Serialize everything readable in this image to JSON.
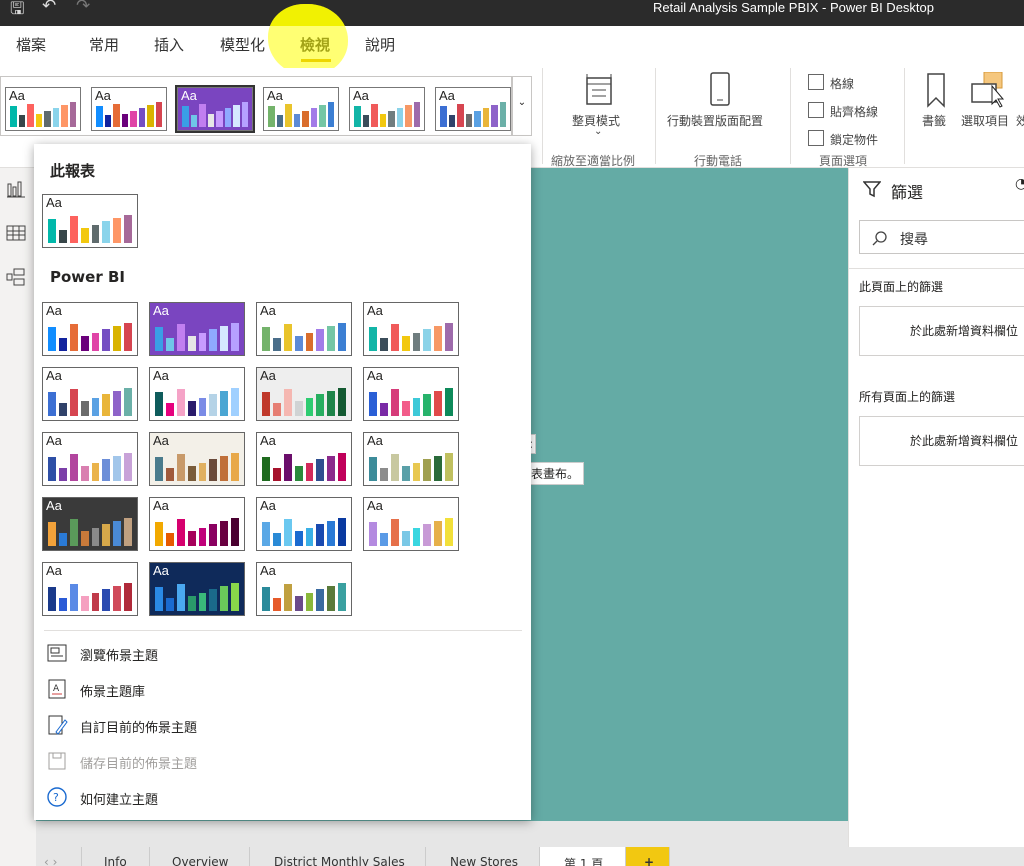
{
  "window": {
    "title": "Retail Analysis Sample PBIX - Power BI Desktop"
  },
  "tabs": [
    {
      "label": "檔案"
    },
    {
      "label": "常用"
    },
    {
      "label": "插入"
    },
    {
      "label": "模型化"
    },
    {
      "label": "檢視"
    },
    {
      "label": "說明"
    }
  ],
  "ribbon": {
    "page_view": "整頁模式",
    "page_view_group": "縮放至適當比例",
    "mobile_layout": "行動裝置版面配置",
    "mobile_group": "行動電話",
    "gridlines": "格線",
    "snap_to_grid": "貼齊格線",
    "lock_objects": "鎖定物件",
    "page_options_group": "頁面選項",
    "bookmarks": "書籤",
    "selection": "選取項目",
    "selection_cut": "效"
  },
  "dropdown": {
    "this_report_header": "此報表",
    "powerbi_header": "Power BI",
    "thumb_text": "Aa",
    "menu": [
      {
        "label": "瀏覽佈景主題",
        "icon": "browse-theme-icon",
        "enabled": true
      },
      {
        "label": "佈景主題庫",
        "icon": "theme-gallery-icon",
        "enabled": true
      },
      {
        "label": "自訂目前的佈景主題",
        "icon": "customize-theme-icon",
        "enabled": true
      },
      {
        "label": "儲存目前的佈景主題",
        "icon": "save-theme-icon",
        "enabled": false
      },
      {
        "label": "如何建立主題",
        "icon": "help-icon",
        "enabled": true
      }
    ]
  },
  "themes": {
    "this_report": [
      {
        "bg": "#ffffff",
        "fg": "#252423",
        "colors": [
          "#01b8aa",
          "#374649",
          "#fd625e",
          "#f2c80f",
          "#5f6b6d",
          "#8ad4eb",
          "#fe9666",
          "#a66999"
        ]
      }
    ],
    "ribbon": [
      {
        "bg": "#ffffff",
        "fg": "#252423",
        "colors": [
          "#01b8aa",
          "#374649",
          "#fd625e",
          "#f2c80f",
          "#5f6b6d",
          "#8ad4eb",
          "#fe9666",
          "#a66999"
        ]
      },
      {
        "bg": "#ffffff",
        "fg": "#252423",
        "colors": [
          "#118dff",
          "#12239e",
          "#e66c37",
          "#6b007b",
          "#e044a7",
          "#744ec2",
          "#d9b300",
          "#d64550"
        ]
      },
      {
        "bg": "#7a45c0",
        "fg": "#ffffff",
        "colors": [
          "#3a9ee6",
          "#6fc6e8",
          "#c17ff0",
          "#e6e6e6",
          "#c89bff",
          "#8fa9ff",
          "#d5e7ff",
          "#b6a1ff"
        ]
      },
      {
        "bg": "#ffffff",
        "fg": "#252423",
        "colors": [
          "#74b36b",
          "#4a6e8a",
          "#e9c42c",
          "#5c8ad6",
          "#d96d2c",
          "#a27ce8",
          "#74c6a5",
          "#3c7fd3"
        ]
      },
      {
        "bg": "#ffffff",
        "fg": "#252423",
        "colors": [
          "#12b5a7",
          "#3b4d5a",
          "#f05a5a",
          "#f2c80f",
          "#6f7d7f",
          "#8bd3e8",
          "#f79865",
          "#9e6bab"
        ]
      },
      {
        "bg": "#ffffff",
        "fg": "#252423",
        "colors": [
          "#3c6fd3",
          "#30426a",
          "#d64550",
          "#6b6b6b",
          "#5aa1e3",
          "#e9b53a",
          "#8e63c9",
          "#6bb0a8"
        ]
      }
    ],
    "powerbi": [
      {
        "bg": "#ffffff",
        "fg": "#252423",
        "colors": [
          "#118dff",
          "#12239e",
          "#e66c37",
          "#6b007b",
          "#e044a7",
          "#744ec2",
          "#d9b300",
          "#d64550"
        ]
      },
      {
        "bg": "#7a45c0",
        "fg": "#ffffff",
        "colors": [
          "#3a9ee6",
          "#6fc6e8",
          "#c17ff0",
          "#e6e6e6",
          "#c89bff",
          "#8fa9ff",
          "#d5e7ff",
          "#b6a1ff"
        ]
      },
      {
        "bg": "#ffffff",
        "fg": "#252423",
        "colors": [
          "#74b36b",
          "#4a6e8a",
          "#e9c42c",
          "#5c8ad6",
          "#d96d2c",
          "#a27ce8",
          "#74c6a5",
          "#3c7fd3"
        ]
      },
      {
        "bg": "#ffffff",
        "fg": "#252423",
        "colors": [
          "#12b5a7",
          "#3b4d5a",
          "#f05a5a",
          "#f2c80f",
          "#6f7d7f",
          "#8bd3e8",
          "#f79865",
          "#9e6bab"
        ]
      },
      {
        "bg": "#ffffff",
        "fg": "#252423",
        "colors": [
          "#3c6fd3",
          "#30426a",
          "#d64550",
          "#6b6b6b",
          "#5aa1e3",
          "#e9b53a",
          "#8e63c9",
          "#6bb0a8"
        ]
      },
      {
        "bg": "#ffffff",
        "fg": "#252423",
        "colors": [
          "#0f5c5c",
          "#e6007e",
          "#f5a3c7",
          "#2a1b6b",
          "#7a8be6",
          "#b5d3e7",
          "#4aa6d3",
          "#a0d0ff"
        ]
      },
      {
        "bg": "#eeeeee",
        "fg": "#252423",
        "colors": [
          "#c0392b",
          "#e67e73",
          "#f5b7b1",
          "#d0d3d4",
          "#2ecc71",
          "#27ae60",
          "#1e8449",
          "#145a32"
        ]
      },
      {
        "bg": "#ffffff",
        "fg": "#252423",
        "colors": [
          "#2a5fd6",
          "#7a2aa6",
          "#d63c7a",
          "#f25c8a",
          "#3dc9d8",
          "#27b36b",
          "#e04a4a",
          "#0e8a5a"
        ]
      },
      {
        "bg": "#ffffff",
        "fg": "#252423",
        "colors": [
          "#2e4fa6",
          "#7b3fa8",
          "#b2459e",
          "#d97fb0",
          "#eab34b",
          "#6c8ed8",
          "#a2c6ea",
          "#c8a2d8"
        ]
      },
      {
        "bg": "#f3f0e8",
        "fg": "#252423",
        "colors": [
          "#4a7b8c",
          "#a05a3c",
          "#c89a6a",
          "#7a5c3a",
          "#e0b060",
          "#6a4a3a",
          "#c0703a",
          "#e8a848"
        ]
      },
      {
        "bg": "#ffffff",
        "fg": "#252423",
        "colors": [
          "#1f6b1f",
          "#a6122c",
          "#6b0e6b",
          "#2a8a3a",
          "#d22a5a",
          "#2f4f8f",
          "#8b2a8b",
          "#c0005a"
        ]
      },
      {
        "bg": "#ffffff",
        "fg": "#252423",
        "colors": [
          "#3c8c9a",
          "#8c8c8c",
          "#c8c8a0",
          "#5aa0a8",
          "#e8c850",
          "#a0a050",
          "#2a6a3a",
          "#c0c060"
        ]
      },
      {
        "bg": "#3a3a3a",
        "fg": "#ffffff",
        "colors": [
          "#f2a23a",
          "#2a7ad6",
          "#5a9a5a",
          "#c87a3a",
          "#8a8a8a",
          "#d6a84a",
          "#4a8ad6",
          "#c0a080"
        ]
      },
      {
        "bg": "#ffffff",
        "fg": "#252423",
        "colors": [
          "#f2a900",
          "#e65a00",
          "#d6006e",
          "#a6005a",
          "#c0007a",
          "#8a0060",
          "#6a0040",
          "#4a0030"
        ]
      },
      {
        "bg": "#ffffff",
        "fg": "#252423",
        "colors": [
          "#5aa8e6",
          "#2a8ad6",
          "#6ac8f0",
          "#1a6ad0",
          "#3ab0e6",
          "#1a4ab0",
          "#2a7ad6",
          "#0a3aa0"
        ]
      },
      {
        "bg": "#ffffff",
        "fg": "#252423",
        "colors": [
          "#b48ae0",
          "#5a9ae6",
          "#e6704a",
          "#7ac8e6",
          "#3ad6e0",
          "#c89ad6",
          "#e6b04a",
          "#f2e03a"
        ]
      },
      {
        "bg": "#ffffff",
        "fg": "#252423",
        "colors": [
          "#1a3a8a",
          "#2a5ad6",
          "#5a8ae6",
          "#f5a0c0",
          "#c03a4a",
          "#2a4ab0",
          "#d04a5a",
          "#b02a3a"
        ]
      },
      {
        "bg": "#0f2a5a",
        "fg": "#ffffff",
        "colors": [
          "#2a8ae6",
          "#1a6ad0",
          "#4aa8f0",
          "#2a9a6a",
          "#3ab87a",
          "#1a6a8a",
          "#6ac85a",
          "#8ad64a"
        ]
      },
      {
        "bg": "#ffffff",
        "fg": "#252423",
        "colors": [
          "#2a8a9a",
          "#e65a2a",
          "#c0a040",
          "#6a4a8a",
          "#8ab83a",
          "#3a6aa0",
          "#5a7a3a",
          "#3aa0a0"
        ]
      }
    ]
  },
  "canvas": {
    "stub_top": ":",
    "stub_text": "表畫布。"
  },
  "filters": {
    "title": "篩選",
    "search_placeholder": "搜尋",
    "this_page": "此頁面上的篩選",
    "add_field": "於此處新增資料欄位",
    "all_pages": "所有頁面上的篩選"
  },
  "page_tabs": [
    {
      "label": "Info"
    },
    {
      "label": "Overview"
    },
    {
      "label": "District Monthly Sales"
    },
    {
      "label": "New Stores"
    },
    {
      "label": "第 1 頁"
    },
    {
      "label": "+"
    }
  ],
  "colors": {
    "accent": "#d8a400",
    "canvas": "#64aba5",
    "highlight": "#ffff00"
  }
}
